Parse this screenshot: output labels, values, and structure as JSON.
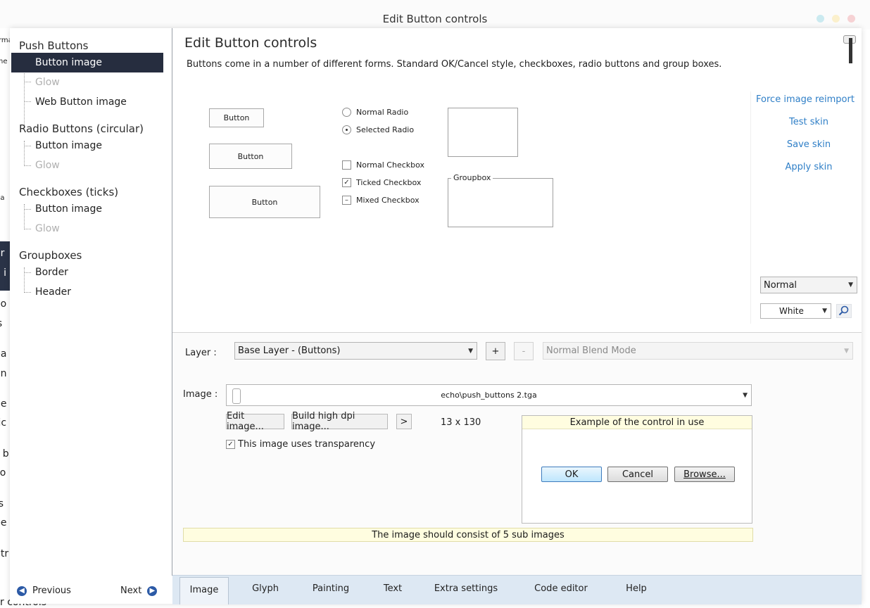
{
  "window": {
    "title": "Edit Button controls"
  },
  "background_fragments": [
    "rma",
    "ne",
    "pa",
    "or",
    "e i",
    "oo",
    "is",
    "pa",
    "on",
    "ne",
    "tic",
    "s b",
    "co",
    "rs",
    "pe",
    "ntr",
    "a",
    "r controls"
  ],
  "sidebar": {
    "sections": [
      {
        "title": "Push Buttons",
        "items": [
          {
            "label": "Button image",
            "state": "selected"
          },
          {
            "label": "Glow",
            "state": "disabled"
          },
          {
            "label": "Web Button image",
            "state": "normal"
          }
        ]
      },
      {
        "title": "Radio Buttons (circular)",
        "items": [
          {
            "label": "Button image",
            "state": "normal"
          },
          {
            "label": "Glow",
            "state": "disabled"
          }
        ]
      },
      {
        "title": "Checkboxes (ticks)",
        "items": [
          {
            "label": "Button image",
            "state": "normal"
          },
          {
            "label": "Glow",
            "state": "disabled"
          }
        ]
      },
      {
        "title": "Groupboxes",
        "items": [
          {
            "label": "Border",
            "state": "normal"
          },
          {
            "label": "Header",
            "state": "normal"
          }
        ]
      }
    ],
    "previous_label": "Previous",
    "next_label": "Next"
  },
  "main": {
    "heading": "Edit Button controls",
    "description": "Buttons come in a number of different forms.  Standard OK/Cancel style, checkboxes, radio buttons and group boxes.",
    "preview": {
      "buttons": [
        "Button",
        "Button",
        "Button"
      ],
      "radios": [
        {
          "label": "Normal Radio",
          "checked": false
        },
        {
          "label": "Selected Radio",
          "checked": true
        }
      ],
      "checkboxes": [
        {
          "label": "Normal Checkbox",
          "state": "unchecked",
          "mark": ""
        },
        {
          "label": "Ticked Checkbox",
          "state": "checked",
          "mark": "✓"
        },
        {
          "label": "Mixed Checkbox",
          "state": "mixed",
          "mark": "–"
        }
      ],
      "groupbox_label": "Groupbox"
    },
    "actions": {
      "force_reimport": "Force image reimport",
      "test_skin": "Test skin",
      "save_skin": "Save skin",
      "apply_skin": "Apply skin",
      "state_select": "Normal",
      "bg_select": "White"
    }
  },
  "editor": {
    "layer_label": "Layer :",
    "layer_value": "Base Layer - (Buttons)",
    "add_label": "+",
    "remove_label": "-",
    "blend_value": "Normal Blend Mode",
    "image_label": "Image :",
    "image_path": "echo\\push_buttons 2.tga",
    "edit_image": "Edit image...",
    "build_hdpi": "Build high dpi image...",
    "more": ">",
    "dimensions": "13 x 130",
    "transparency_label": "This image uses transparency",
    "transparency_checked": true,
    "example_title": "Example of the control in use",
    "example_ok": "OK",
    "example_cancel": "Cancel",
    "example_browse": "Browse...",
    "note": "The image should consist of 5 sub images"
  },
  "tabs": [
    {
      "label": "Image",
      "active": true
    },
    {
      "label": "Glyph",
      "active": false
    },
    {
      "label": "Painting",
      "active": false
    },
    {
      "label": "Text",
      "active": false
    },
    {
      "label": "Extra settings",
      "active": false
    },
    {
      "label": "Code editor",
      "active": false
    },
    {
      "label": "Help",
      "active": false
    }
  ],
  "colors": {
    "selection": "#262d3f",
    "link": "#2f7fc7",
    "note_bg": "#fffde0",
    "tabbar": "#dde8f3"
  }
}
